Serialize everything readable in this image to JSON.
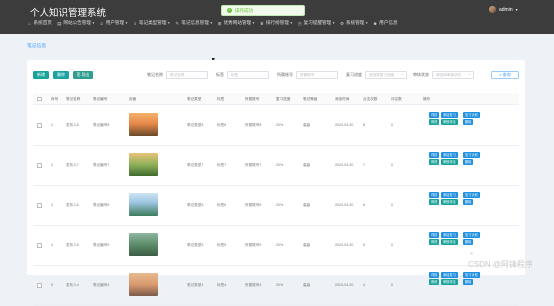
{
  "header": {
    "app_title": "个人知识管理系统",
    "user_name": "admin",
    "nav": [
      {
        "label": "系统首页",
        "icon": "home-icon"
      },
      {
        "label": "网站公告管理",
        "icon": "notice-icon"
      },
      {
        "label": "用户管理",
        "icon": "user-icon"
      },
      {
        "label": "笔记类型管理",
        "icon": "type-icon"
      },
      {
        "label": "笔记信息管理",
        "icon": "note-icon"
      },
      {
        "label": "优秀网站管理",
        "icon": "site-icon"
      },
      {
        "label": "排行榜管理",
        "icon": "rank-icon"
      },
      {
        "label": "复习提醒管理",
        "icon": "remind-icon"
      },
      {
        "label": "系统管理",
        "icon": "gear-icon"
      },
      {
        "label": "用户信息",
        "icon": "profile-icon"
      }
    ]
  },
  "toast": {
    "text": "操作成功",
    "icon": "check-icon",
    "color": "#67c23a"
  },
  "breadcrumb": "笔记信息",
  "toolbar": {
    "add_label": "新增",
    "delete_label": "删除",
    "export_label": "导出"
  },
  "filters": {
    "name_label": "笔记名称",
    "name_placeholder": "笔记名称",
    "tag_label": "标签",
    "tag_placeholder": "标签",
    "account_label": "所属账号",
    "account_placeholder": "所属账号",
    "review_label": "复习进度",
    "review_placeholder": "请选择复习进度",
    "status_label": "审核状态",
    "status_placeholder": "请选择审核状态",
    "search_label": "查询"
  },
  "table": {
    "columns": [
      "序号",
      "笔记名称",
      "笔记编号",
      "封面",
      "笔记类型",
      "标签",
      "所属账号",
      "复习进度",
      "笔记等级",
      "添加时间",
      "点击次数",
      "评论数",
      "操作"
    ],
    "rows": [
      {
        "index": "1",
        "name": "发布人8",
        "code": "笔记编号8",
        "type": "笔记类型8",
        "tag": "标签8",
        "account": "所属账号8",
        "progress": "20%",
        "level": "高级",
        "date": "2024-04-20",
        "clicks": "8",
        "comments": "0",
        "thumb": "sunset-field-icon"
      },
      {
        "index": "2",
        "name": "发布人7",
        "code": "笔记编号7",
        "type": "笔记类型7",
        "tag": "标签7",
        "account": "所属账号7",
        "progress": "20%",
        "level": "高级",
        "date": "2024-04-20",
        "clicks": "7",
        "comments": "0",
        "thumb": "forest-path-icon"
      },
      {
        "index": "3",
        "name": "发布人6",
        "code": "笔记编号6",
        "type": "笔记类型6",
        "tag": "标签6",
        "account": "所属账号6",
        "progress": "20%",
        "level": "高级",
        "date": "2024-04-20",
        "clicks": "6",
        "comments": "0",
        "thumb": "village-icon"
      },
      {
        "index": "4",
        "name": "发布人5",
        "code": "笔记编号5",
        "type": "笔记类型5",
        "tag": "标签5",
        "account": "所属账号5",
        "progress": "20%",
        "level": "高级",
        "date": "2024-04-20",
        "clicks": "5",
        "comments": "0",
        "thumb": "trees-icon"
      },
      {
        "index": "5",
        "name": "发布人4",
        "code": "笔记编号4",
        "type": "笔记类型4",
        "tag": "标签4",
        "account": "所属账号4",
        "progress": "20%",
        "level": "高级",
        "date": "2024-04-20",
        "clicks": "4",
        "comments": "0",
        "thumb": "lake-sunset-icon"
      }
    ],
    "ops": [
      "详情",
      "添加复习",
      "复习计划",
      "修改",
      "审核评论",
      "删除"
    ]
  },
  "watermark": "CSDN @阿锋程序",
  "colors": {
    "accent": "#409eff",
    "teal": "#1aa39b",
    "topbar": "#3c3c3c",
    "success": "#67c23a"
  }
}
